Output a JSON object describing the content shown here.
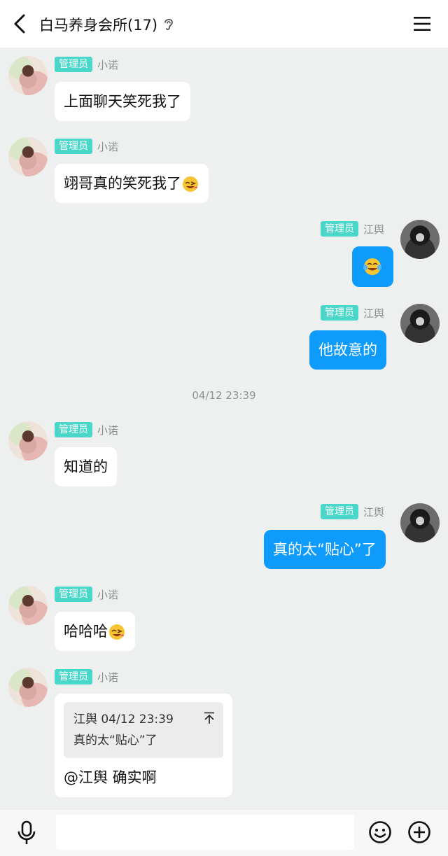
{
  "header": {
    "title": "白马养身会所(17)"
  },
  "roles": {
    "admin": "管理员"
  },
  "users": {
    "left": "小诺",
    "right": "江舆"
  },
  "messages": [
    {
      "text": "上面聊天笑死我了"
    },
    {
      "text": "翊哥真的笑死我了"
    },
    {
      "text": ""
    },
    {
      "text": "他故意的"
    },
    {
      "text": "知道的"
    },
    {
      "text": "真的太“贴心”了"
    },
    {
      "text": "哈哈哈"
    },
    {
      "text": "@江舆 确实啊"
    }
  ],
  "timestamp": "04/12 23:39",
  "quote": {
    "author_time": "江舆 04/12 23:39",
    "text": "真的太“贴心”了"
  },
  "input": {
    "placeholder": ""
  },
  "colors": {
    "bubble_blue": "#0e9bfb",
    "badge_teal": "#4ad6c9",
    "background": "#edf0ee"
  },
  "icons": [
    "back-icon",
    "ear-icon",
    "menu-icon",
    "microphone-icon",
    "emoji-icon",
    "plus-icon",
    "pin-top-icon"
  ]
}
